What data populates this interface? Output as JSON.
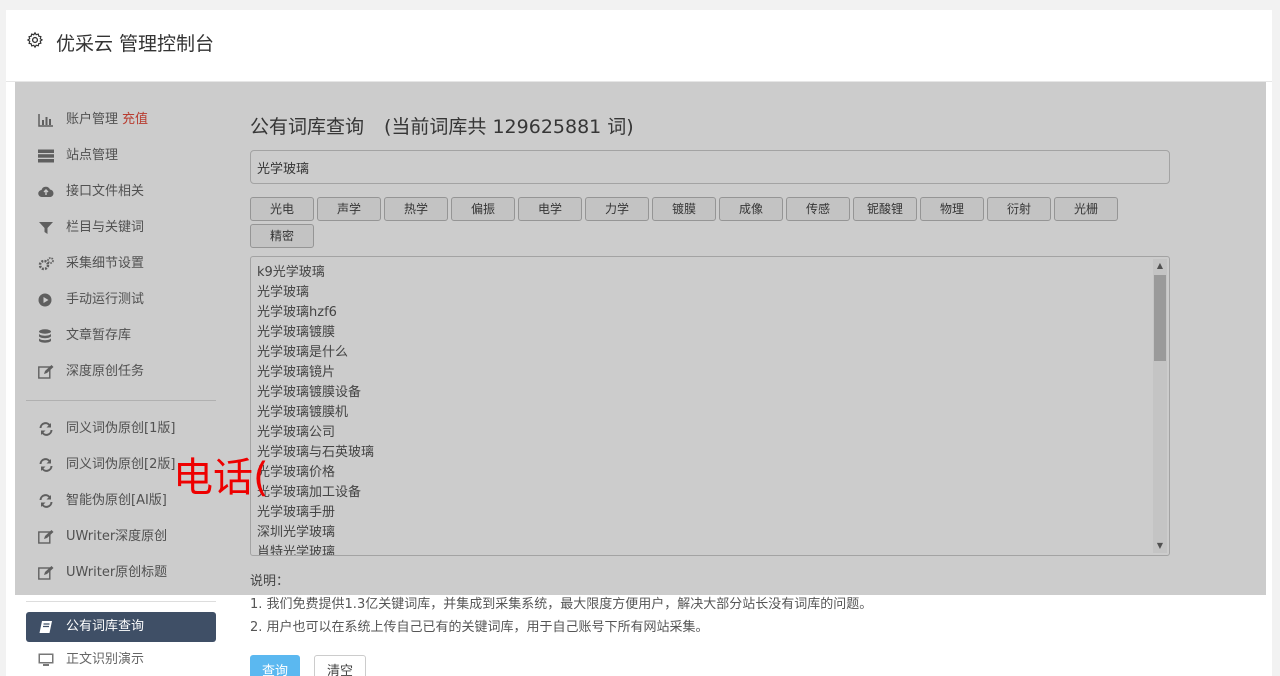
{
  "header": {
    "title": "优采云 管理控制台"
  },
  "sidebar": {
    "group1": [
      {
        "label": "账户管理",
        "promo": "充值",
        "icon": "bar-chart-icon"
      },
      {
        "label": "站点管理",
        "icon": "server-icon"
      },
      {
        "label": "接口文件相关",
        "icon": "cloud-upload-icon"
      },
      {
        "label": "栏目与关键词",
        "icon": "filter-icon"
      },
      {
        "label": "采集细节设置",
        "icon": "gears-icon"
      },
      {
        "label": "手动运行测试",
        "icon": "play-circle-icon"
      },
      {
        "label": "文章暂存库",
        "icon": "database-icon"
      },
      {
        "label": "深度原创任务",
        "icon": "edit-icon"
      }
    ],
    "group2": [
      {
        "label": "同义词伪原创[1版]",
        "icon": "refresh-icon"
      },
      {
        "label": "同义词伪原创[2版]",
        "icon": "refresh-icon"
      },
      {
        "label": "智能伪原创[AI版]",
        "icon": "refresh-icon"
      },
      {
        "label": "UWriter深度原创",
        "icon": "edit-icon"
      },
      {
        "label": "UWriter原创标题",
        "icon": "edit-icon"
      }
    ],
    "group3": [
      {
        "label": "公有词库查询",
        "icon": "book-icon",
        "active": true
      },
      {
        "label": "正文识别演示",
        "icon": "monitor-icon"
      }
    ]
  },
  "main": {
    "title": "公有词库查询",
    "count_text": "(当前词库共 129625881 词)",
    "query_value": "光学玻璃",
    "tags": [
      "光电",
      "声学",
      "热学",
      "偏振",
      "电学",
      "力学",
      "镀膜",
      "成像",
      "传感",
      "铌酸锂",
      "物理",
      "衍射",
      "光栅",
      "精密"
    ],
    "results": [
      "k9光学玻璃",
      "光学玻璃",
      "光学玻璃hzf6",
      "光学玻璃镀膜",
      "光学玻璃是什么",
      "光学玻璃镜片",
      "光学玻璃镀膜设备",
      "光学玻璃镀膜机",
      "光学玻璃公司",
      "光学玻璃与石英玻璃",
      "光学玻璃价格",
      "光学玻璃加工设备",
      "光学玻璃手册",
      "深圳光学玻璃",
      "肖特光学玻璃"
    ],
    "notes": {
      "heading": "说明：",
      "line1": "1. 我们免费提供1.3亿关键词库，并集成到采集系统，最大限度方便用户，解决大部分站长没有词库的问题。",
      "line2": "2. 用户也可以在系统上传自己已有的关键词库，用于自己账号下所有网站采集。"
    },
    "buttons": {
      "query": "查询",
      "clear": "清空"
    }
  },
  "overlay_text": "电话(",
  "colors": {
    "active_bg": "#3f4f66",
    "primary": "#5bb8f0",
    "promo": "#e74c3c",
    "watermark": "#ee0000"
  }
}
